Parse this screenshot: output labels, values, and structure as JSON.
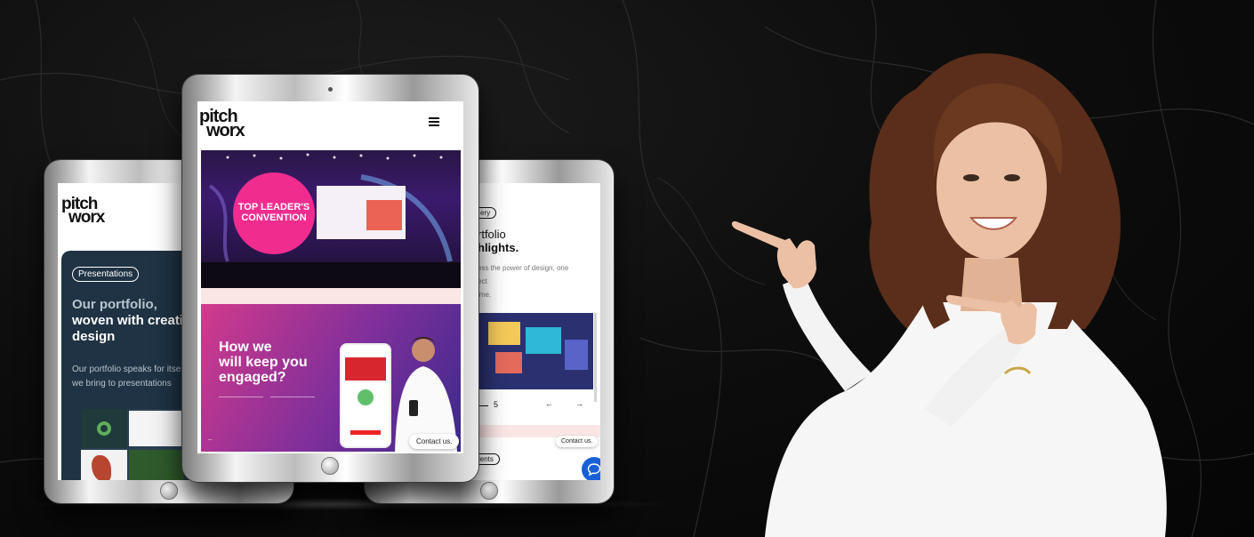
{
  "brand": {
    "logo_line1": "pitch",
    "logo_line2": "worx"
  },
  "left_screen": {
    "tag": "Presentations",
    "title_line1": "Our portfolio,",
    "title_line2": "woven with creati",
    "title_line3": "design",
    "body_line1": "Our portfolio speaks for itsel",
    "body_line2": "we bring to presentations"
  },
  "center_screen": {
    "hero_circle_line1": "TOP LEADER'S",
    "hero_circle_line2": "CONVENTION",
    "promo_title_line1": "How we",
    "promo_title_line2": "will keep you",
    "promo_title_line3": "engaged?",
    "contact": "Contact us."
  },
  "right_screen": {
    "tag": "ery",
    "title_line1": "rtfolio",
    "title_line2": "hlights.",
    "body_line1": "ess the power of design, one",
    "body_line2": "ect",
    "body_line3": "ime.",
    "page_number": "5",
    "contact": "Contact us.",
    "tag2": "ients"
  },
  "colors": {
    "background": "#0b0b0b",
    "accent_pink": "#f02c8f",
    "card_navy": "#1f3344",
    "chat_blue": "#1960d8"
  },
  "icons": [
    "hamburger-menu-icon",
    "arrow-left-icon",
    "arrow-right-icon",
    "chat-bubble-icon"
  ]
}
